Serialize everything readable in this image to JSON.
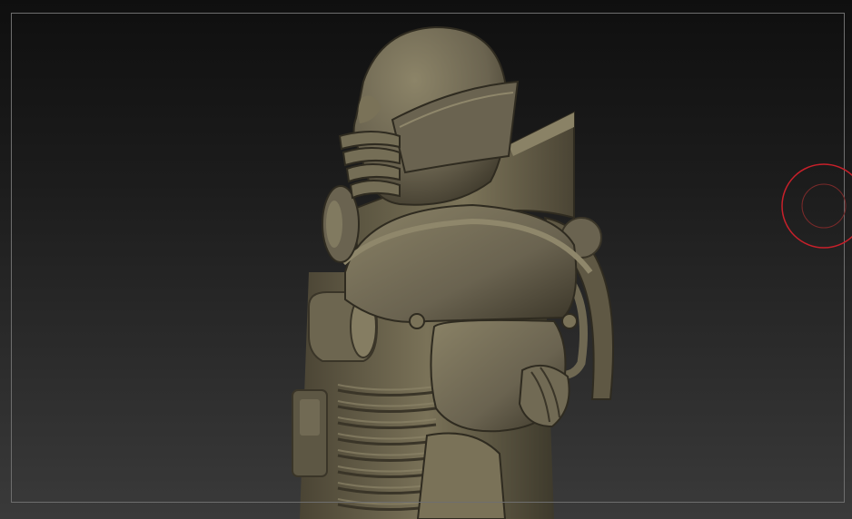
{
  "canvas": {
    "background_top": "#0f0f0f",
    "background_bottom": "#3a3a3a",
    "frame_color": "#6e6e6e"
  },
  "model": {
    "material_color": "#6b6450",
    "highlight_color": "#8c8468",
    "shadow_color": "#3a3528"
  },
  "cursor": {
    "icon": "brush-cursor-icon",
    "color": "#c8202a"
  }
}
